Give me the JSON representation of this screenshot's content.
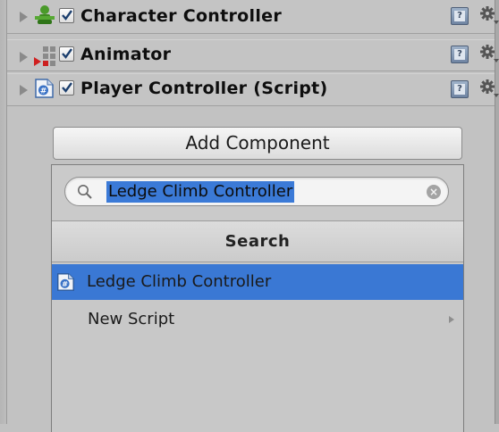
{
  "components": [
    {
      "name": "Character Controller",
      "enabled": true,
      "icon": "character-controller-icon"
    },
    {
      "name": "Animator",
      "enabled": true,
      "icon": "animator-icon"
    },
    {
      "name": "Player Controller (Script)",
      "enabled": true,
      "icon": "csharp-script-icon"
    }
  ],
  "add_component": {
    "button_label": "Add Component",
    "search": {
      "value": "Ledge Climb Controller"
    },
    "header": "Search",
    "results": [
      {
        "label": "Ledge Climb Controller",
        "icon": "csharp-script-icon",
        "selected": true
      },
      {
        "label": "New Script",
        "submenu": true
      }
    ]
  },
  "colors": {
    "selection": "#3a78d4",
    "background": "#c2c2c2"
  }
}
